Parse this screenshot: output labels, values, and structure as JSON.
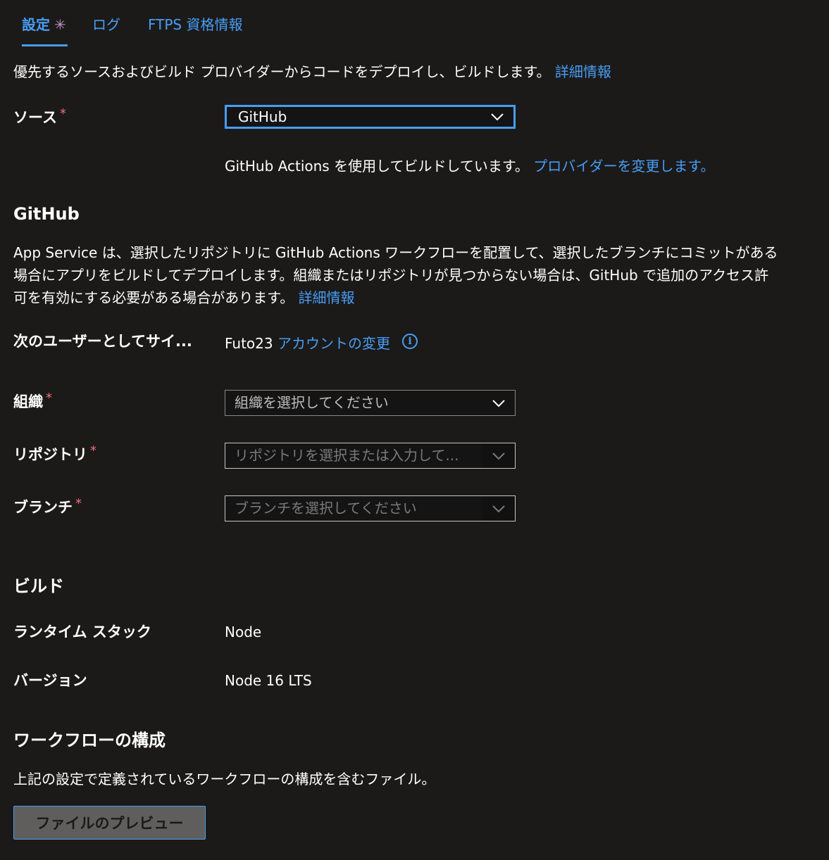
{
  "tabs": [
    {
      "label": "設定",
      "modified": "✳"
    },
    {
      "label": "ログ"
    },
    {
      "label": "FTPS 資格情報"
    }
  ],
  "intro": {
    "text": "優先するソースおよびビルド プロバイダーからコードをデプロイし、ビルドします。",
    "link": "詳細情報"
  },
  "source": {
    "label": "ソース",
    "required": "*",
    "value": "GitHub",
    "helper_text": "GitHub Actions を使用してビルドしています。",
    "helper_link": "プロバイダーを変更します。"
  },
  "github": {
    "title": "GitHub",
    "desc_line1": "App Service は、選択したリポジトリに GitHub Actions ワークフローを配置して、選択したブランチにコミットがある",
    "desc_line2": "場合にアプリをビルドしてデプロイします。組織またはリポジトリが見つからない場合は、GitHub で追加のアクセス許",
    "desc_line3": "可を有効にする必要がある場合があります。",
    "desc_link": "詳細情報",
    "signin_label": "次のユーザーとしてサイ...",
    "user": "Futo23",
    "change_account": "アカウントの変更",
    "info_glyph": "i",
    "org": {
      "label": "組織",
      "required": "*",
      "placeholder": "組織を選択してください"
    },
    "repo": {
      "label": "リポジトリ",
      "required": "*",
      "placeholder": "リポジトリを選択または入力して..."
    },
    "branch": {
      "label": "ブランチ",
      "required": "*",
      "placeholder": "ブランチを選択してください"
    }
  },
  "build": {
    "title": "ビルド",
    "runtime_label": "ランタイム スタック",
    "runtime_value": "Node",
    "version_label": "バージョン",
    "version_value": "Node 16 LTS"
  },
  "workflow": {
    "title": "ワークフローの構成",
    "desc": "上記の設定で定義されているワークフローの構成を含むファイル。",
    "preview_button": "ファイルのプレビュー"
  },
  "colors": {
    "background": "#1b1a19",
    "link": "#479ef5",
    "required": "#f1707b",
    "modified": "#c392c9"
  }
}
